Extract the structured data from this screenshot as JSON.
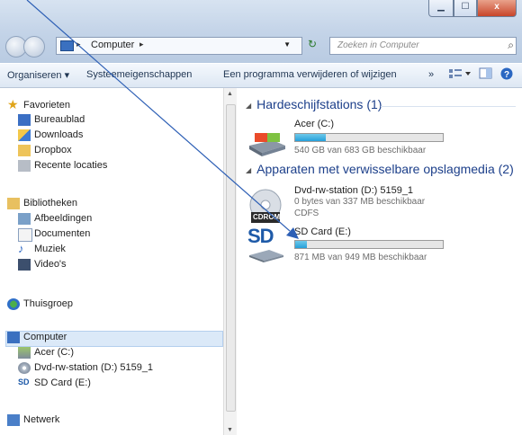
{
  "window": {
    "controls": {
      "minimize": "▁",
      "maximize": "☐",
      "close": "x"
    }
  },
  "address": {
    "path": "Computer",
    "search_placeholder": "Zoeken in Computer"
  },
  "toolbar": {
    "organize": "Organiseren ▾",
    "system_properties": "Systeemeigenschappen",
    "uninstall": "Een programma verwijderen of wijzigen",
    "more": "»"
  },
  "sidebar": {
    "favorites": "Favorieten",
    "desktop": "Bureaublad",
    "downloads": "Downloads",
    "dropbox": "Dropbox",
    "recent": "Recente locaties",
    "libraries": "Bibliotheken",
    "pictures": "Afbeeldingen",
    "documents": "Documenten",
    "music": "Muziek",
    "videos": "Video's",
    "homegroup": "Thuisgroep",
    "computer": "Computer",
    "drive_c": "Acer (C:)",
    "drive_d": "Dvd-rw-station (D:) 5159_1",
    "drive_e": "SD Card (E:)",
    "network": "Netwerk"
  },
  "content": {
    "hdd_group": "Hardeschijfstations (1)",
    "removable_group": "Apparaten met verwisselbare opslagmedia (2)",
    "drives": [
      {
        "name": "Acer (C:)",
        "status": "540 GB van 683 GB beschikbaar",
        "used_fraction": 0.21
      },
      {
        "name": "Dvd-rw-station (D:) 5159_1",
        "status": "0 bytes van 337 MB beschikbaar",
        "fs": "CDFS",
        "badge": "CDROM"
      },
      {
        "name": "SD Card (E:)",
        "status": "871 MB van 949 MB beschikbaar",
        "used_fraction": 0.08,
        "logo": "SD"
      }
    ]
  },
  "colors": {
    "accent": "#26a0da",
    "group_header": "#1c3f8a",
    "arrow": "#2d5fb5"
  }
}
